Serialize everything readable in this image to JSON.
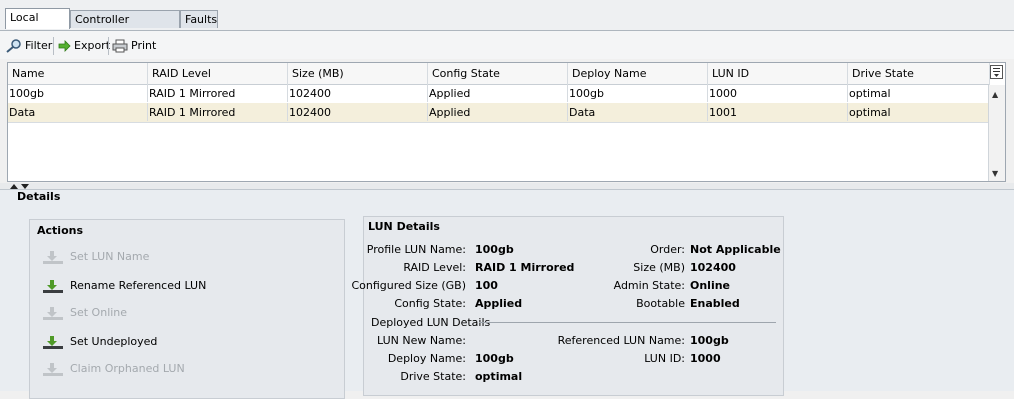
{
  "tabs": [
    {
      "label": "Local LUNs",
      "active": true
    },
    {
      "label": "Controller Definitions",
      "active": false
    },
    {
      "label": "Faults",
      "active": false
    }
  ],
  "toolbar": {
    "filter_label": "Filter",
    "export_label": "Export",
    "print_label": "Print"
  },
  "table": {
    "columns": [
      "Name",
      "RAID Level",
      "Size (MB)",
      "Config State",
      "Deploy Name",
      "LUN ID",
      "Drive State"
    ],
    "rows": [
      [
        "100gb",
        "RAID 1 Mirrored",
        "102400",
        "Applied",
        "100gb",
        "1000",
        "optimal"
      ],
      [
        "Data",
        "RAID 1 Mirrored",
        "102400",
        "Applied",
        "Data",
        "1001",
        "optimal"
      ]
    ],
    "selected_row": 1
  },
  "details": {
    "title": "Details",
    "actions": {
      "title": "Actions",
      "items": [
        {
          "label": "Set LUN Name",
          "enabled": false
        },
        {
          "label": "Rename Referenced LUN",
          "enabled": true
        },
        {
          "label": "Set Online",
          "enabled": false
        },
        {
          "label": "Set Undeployed",
          "enabled": true
        },
        {
          "label": "Claim Orphaned LUN",
          "enabled": false
        }
      ]
    },
    "lun": {
      "title": "LUN Details",
      "profile_lun_name_label": "Profile LUN Name:",
      "profile_lun_name": "100gb",
      "raid_level_label": "RAID Level:",
      "raid_level": "RAID 1 Mirrored",
      "configured_size_label": "Configured Size (GB)",
      "configured_size": "100",
      "config_state_label": "Config State:",
      "config_state": "Applied",
      "order_label": "Order:",
      "order": "Not Applicable",
      "size_label": "Size (MB)",
      "size": "102400",
      "admin_state_label": "Admin State:",
      "admin_state": "Online",
      "bootable_label": "Bootable",
      "bootable": "Enabled",
      "deployed_heading": "Deployed LUN Details",
      "lun_new_name_label": "LUN New Name:",
      "lun_new_name": "",
      "deploy_name_label": "Deploy Name:",
      "deploy_name": "100gb",
      "drive_state_label": "Drive State:",
      "drive_state": "optimal",
      "referenced_lun_name_label": "Referenced LUN Name:",
      "referenced_lun_name": "100gb",
      "lun_id_label": "LUN ID:",
      "lun_id": "1000"
    }
  }
}
